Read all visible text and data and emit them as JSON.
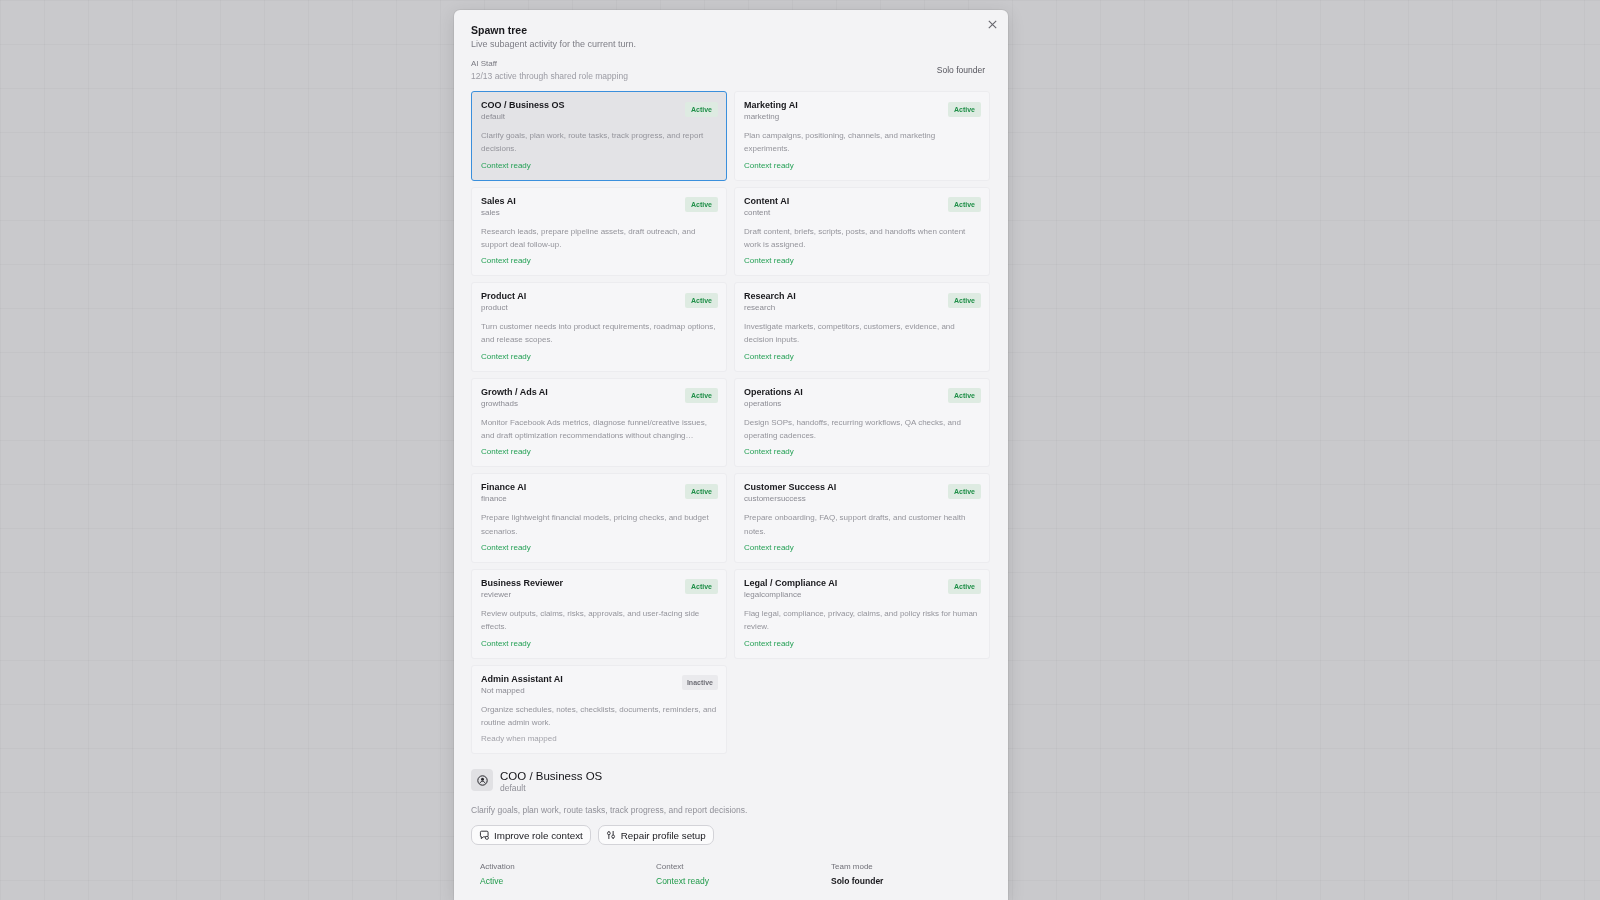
{
  "dialog": {
    "title": "Spawn tree",
    "subtitle": "Live subagent activity for the current turn."
  },
  "staff": {
    "heading": "AI Staff",
    "summary": "12/13 active through shared role mapping",
    "team_mode": "Solo founder"
  },
  "agents": [
    {
      "name": "COO / Business OS",
      "key": "default",
      "status": "Active",
      "active": true,
      "description": "Clarify goals, plan work, route tasks, track progress, and report decisions.",
      "context": "Context ready",
      "selected": true
    },
    {
      "name": "Marketing AI",
      "key": "marketing",
      "status": "Active",
      "active": true,
      "description": "Plan campaigns, positioning, channels, and marketing experiments.",
      "context": "Context ready",
      "selected": false
    },
    {
      "name": "Sales AI",
      "key": "sales",
      "status": "Active",
      "active": true,
      "description": "Research leads, prepare pipeline assets, draft outreach, and support deal follow-up.",
      "context": "Context ready",
      "selected": false
    },
    {
      "name": "Content AI",
      "key": "content",
      "status": "Active",
      "active": true,
      "description": "Draft content, briefs, scripts, posts, and handoffs when content work is assigned.",
      "context": "Context ready",
      "selected": false
    },
    {
      "name": "Product AI",
      "key": "product",
      "status": "Active",
      "active": true,
      "description": "Turn customer needs into product requirements, roadmap options, and release scopes.",
      "context": "Context ready",
      "selected": false
    },
    {
      "name": "Research AI",
      "key": "research",
      "status": "Active",
      "active": true,
      "description": "Investigate markets, competitors, customers, evidence, and decision inputs.",
      "context": "Context ready",
      "selected": false
    },
    {
      "name": "Growth / Ads AI",
      "key": "growthads",
      "status": "Active",
      "active": true,
      "description": "Monitor Facebook Ads metrics, diagnose funnel/creative issues, and draft optimization recommendations without changing…",
      "context": "Context ready",
      "selected": false
    },
    {
      "name": "Operations AI",
      "key": "operations",
      "status": "Active",
      "active": true,
      "description": "Design SOPs, handoffs, recurring workflows, QA checks, and operating cadences.",
      "context": "Context ready",
      "selected": false
    },
    {
      "name": "Finance AI",
      "key": "finance",
      "status": "Active",
      "active": true,
      "description": "Prepare lightweight financial models, pricing checks, and budget scenarios.",
      "context": "Context ready",
      "selected": false
    },
    {
      "name": "Customer Success AI",
      "key": "customersuccess",
      "status": "Active",
      "active": true,
      "description": "Prepare onboarding, FAQ, support drafts, and customer health notes.",
      "context": "Context ready",
      "selected": false
    },
    {
      "name": "Business Reviewer",
      "key": "reviewer",
      "status": "Active",
      "active": true,
      "description": "Review outputs, claims, risks, approvals, and user-facing side effects.",
      "context": "Context ready",
      "selected": false
    },
    {
      "name": "Legal / Compliance AI",
      "key": "legalcompliance",
      "status": "Active",
      "active": true,
      "description": "Flag legal, compliance, privacy, claims, and policy risks for human review.",
      "context": "Context ready",
      "selected": false
    },
    {
      "name": "Admin Assistant AI",
      "key": "Not mapped",
      "status": "Inactive",
      "active": false,
      "description": "Organize schedules, notes, checklists, documents, reminders, and routine admin work.",
      "context": "Ready when mapped",
      "selected": false
    }
  ],
  "detail": {
    "title": "COO / Business OS",
    "key": "default",
    "description": "Clarify goals, plan work, route tasks, track progress, and report decisions.",
    "actions": [
      {
        "label": "Improve role context",
        "kind": "improve"
      },
      {
        "label": "Repair profile setup",
        "kind": "repair"
      }
    ],
    "stats": [
      {
        "label": "Activation",
        "value": "Active",
        "kind": "status"
      },
      {
        "label": "Context",
        "value": "Context ready",
        "kind": "status"
      },
      {
        "label": "Team mode",
        "value": "Solo founder",
        "kind": "plain"
      }
    ]
  }
}
